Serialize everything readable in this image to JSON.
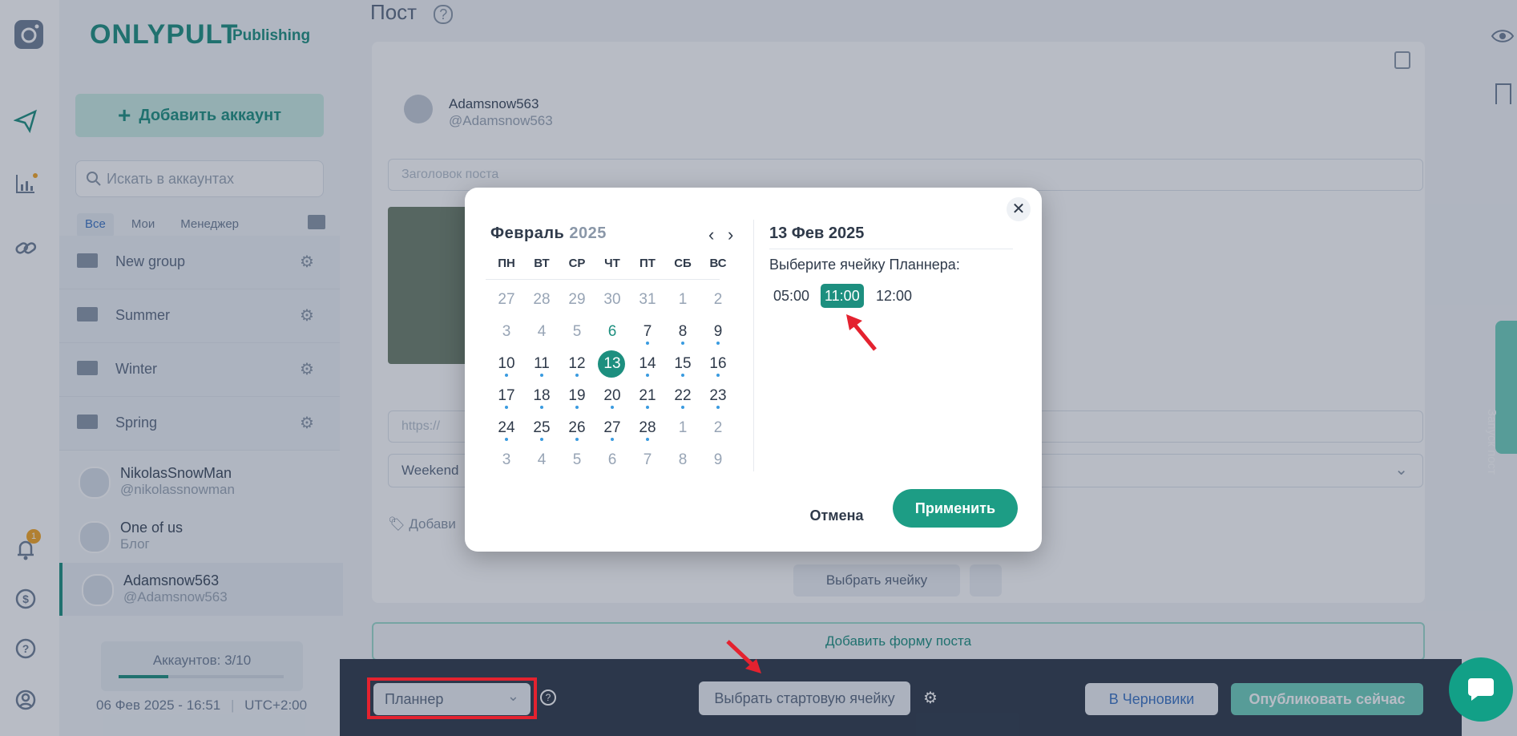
{
  "sidebar": {
    "logo": "ONLYPULT",
    "logo_sub": "Publishing",
    "add_account": "Добавить аккаунт",
    "search_placeholder": "Искать в аккаунтах",
    "tabs": [
      "Все",
      "Мои",
      "Менеджер"
    ],
    "groups": [
      "New group",
      "Summer",
      "Winter",
      "Spring"
    ],
    "accounts": [
      {
        "name": "NikolasSnowMan",
        "handle": "@nikolassnowman"
      },
      {
        "name": "One of us",
        "handle": "Блог"
      },
      {
        "name": "Adamsnow563",
        "handle": "@Adamsnow563"
      }
    ],
    "accounts_count": "Аккаунтов: 3/10",
    "accounts_progress": 0.3,
    "datetime": "06 Фев 2025 - 16:51",
    "timezone": "UTC+2:00",
    "notification_count": "1"
  },
  "main": {
    "title": "Пост",
    "profile_name": "Adamsnow563",
    "profile_handle": "@Adamsnow563",
    "title_placeholder": "Заголовок поста",
    "url_placeholder": "https://",
    "group_select": "Weekend",
    "add_tags": "Добави",
    "select_cell": "Выбрать ячейку",
    "add_post_form": "Добавить форму поста",
    "right_tab": "Запуск пост"
  },
  "footer": {
    "mode_select": "Планнер",
    "start_cell": "Выбрать стартовую ячейку",
    "drafts": "В Черновики",
    "publish_now": "Опубликовать сейчас"
  },
  "modal": {
    "month": "Февраль",
    "year": "2025",
    "weekdays": [
      "ПН",
      "ВТ",
      "СР",
      "ЧТ",
      "ПТ",
      "СБ",
      "ВС"
    ],
    "weeks": [
      [
        {
          "d": "27",
          "t": "out"
        },
        {
          "d": "28",
          "t": "out"
        },
        {
          "d": "29",
          "t": "out"
        },
        {
          "d": "30",
          "t": "out"
        },
        {
          "d": "31",
          "t": "out"
        },
        {
          "d": "1",
          "t": "out"
        },
        {
          "d": "2",
          "t": "out"
        }
      ],
      [
        {
          "d": "3",
          "t": "out"
        },
        {
          "d": "4",
          "t": "out"
        },
        {
          "d": "5",
          "t": "out"
        },
        {
          "d": "6",
          "t": "tod"
        },
        {
          "d": "7",
          "t": "in",
          "dot": true
        },
        {
          "d": "8",
          "t": "in",
          "dot": true
        },
        {
          "d": "9",
          "t": "in",
          "dot": true
        }
      ],
      [
        {
          "d": "10",
          "t": "in",
          "dot": true
        },
        {
          "d": "11",
          "t": "in",
          "dot": true
        },
        {
          "d": "12",
          "t": "in",
          "dot": true
        },
        {
          "d": "13",
          "t": "sel"
        },
        {
          "d": "14",
          "t": "in",
          "dot": true
        },
        {
          "d": "15",
          "t": "in",
          "dot": true
        },
        {
          "d": "16",
          "t": "in",
          "dot": true
        }
      ],
      [
        {
          "d": "17",
          "t": "in",
          "dot": true
        },
        {
          "d": "18",
          "t": "in",
          "dot": true
        },
        {
          "d": "19",
          "t": "in",
          "dot": true
        },
        {
          "d": "20",
          "t": "in",
          "dot": true
        },
        {
          "d": "21",
          "t": "in",
          "dot": true
        },
        {
          "d": "22",
          "t": "in",
          "dot": true
        },
        {
          "d": "23",
          "t": "in",
          "dot": true
        }
      ],
      [
        {
          "d": "24",
          "t": "in",
          "dot": true
        },
        {
          "d": "25",
          "t": "in",
          "dot": true
        },
        {
          "d": "26",
          "t": "in",
          "dot": true
        },
        {
          "d": "27",
          "t": "in",
          "dot": true
        },
        {
          "d": "28",
          "t": "in",
          "dot": true
        },
        {
          "d": "1",
          "t": "out"
        },
        {
          "d": "2",
          "t": "out"
        }
      ],
      [
        {
          "d": "3",
          "t": "out"
        },
        {
          "d": "4",
          "t": "out"
        },
        {
          "d": "5",
          "t": "out"
        },
        {
          "d": "6",
          "t": "out"
        },
        {
          "d": "7",
          "t": "out"
        },
        {
          "d": "8",
          "t": "out"
        },
        {
          "d": "9",
          "t": "out"
        }
      ]
    ],
    "selected_date": "13 Фев 2025",
    "hint": "Выберите ячейку Планнера:",
    "slots": [
      "05:00",
      "11:00",
      "12:00"
    ],
    "selected_slot": "11:00",
    "cancel": "Отмена",
    "apply": "Применить"
  },
  "colors": {
    "accent": "#1d9d85",
    "highlight": "#e4222f",
    "event_dot": "#3a9be0"
  }
}
